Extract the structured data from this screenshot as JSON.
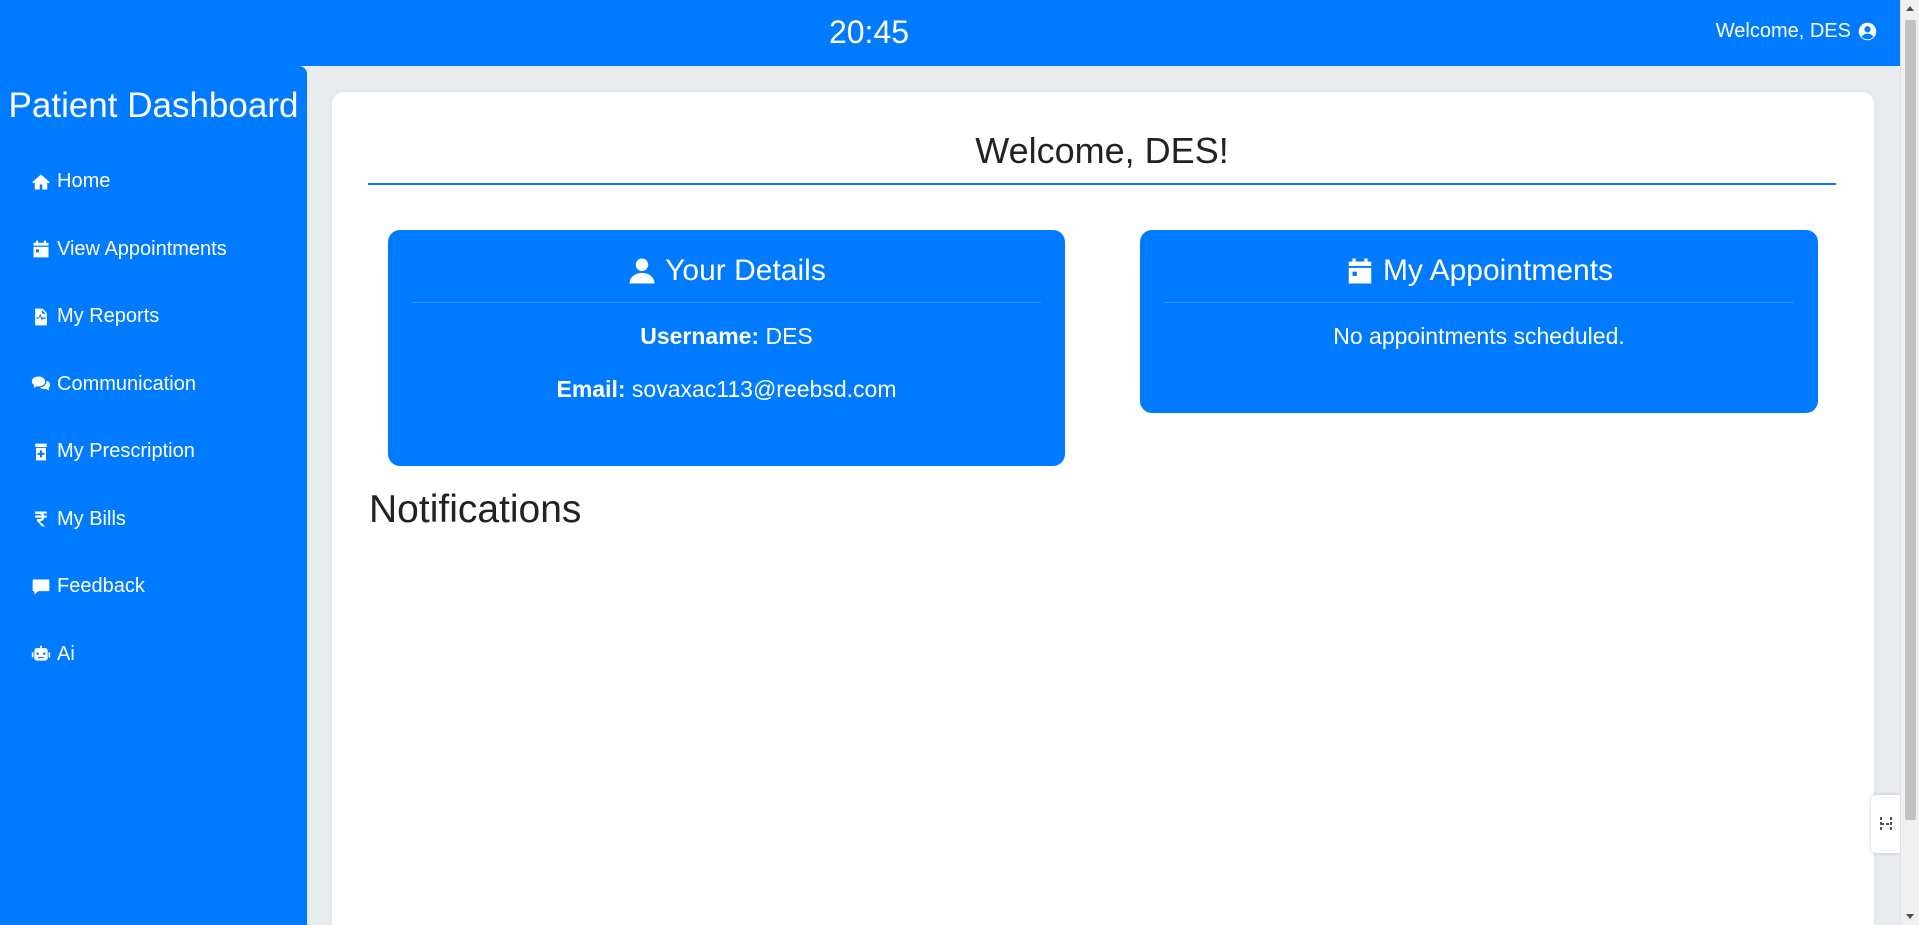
{
  "header": {
    "time": "20:45",
    "welcome": "Welcome, DES",
    "user_icon": "user-circle-icon"
  },
  "sidebar": {
    "title": "Patient Dashboard",
    "items": [
      {
        "label": "Home",
        "icon": "home-icon"
      },
      {
        "label": "View Appointments",
        "icon": "calendar-icon"
      },
      {
        "label": "My Reports",
        "icon": "medical-file-icon"
      },
      {
        "label": "Communication",
        "icon": "comments-icon"
      },
      {
        "label": "My Prescription",
        "icon": "prescription-bottle-icon"
      },
      {
        "label": "My Bills",
        "icon": "rupee-icon"
      },
      {
        "label": "Feedback",
        "icon": "message-icon"
      },
      {
        "label": "Ai",
        "icon": "robot-icon"
      }
    ]
  },
  "main": {
    "title": "Welcome, DES!",
    "details_card": {
      "title": "Your Details",
      "username_label": "Username:",
      "username": "DES",
      "email_label": "Email:",
      "email": "sovaxac113@reebsd.com"
    },
    "appointments_card": {
      "title": "My Appointments",
      "empty_text": "No appointments scheduled."
    },
    "notifications_title": "Notifications"
  },
  "colors": {
    "primary": "#007bff",
    "background": "#e9ecef",
    "panel": "#ffffff"
  }
}
